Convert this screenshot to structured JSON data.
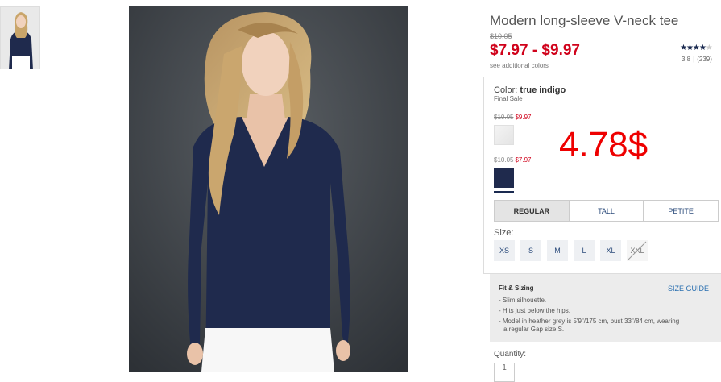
{
  "product": {
    "title": "Modern long-sleeve V-neck tee",
    "old_price": "$10.05",
    "price_range": "$7.97 - $9.97",
    "see_colors": "see additional colors",
    "stars_full": "★★★★",
    "stars_empty": "★",
    "rating_value": "3.8",
    "rating_separator": "|",
    "review_count": "(239)"
  },
  "color": {
    "label": "Color:",
    "name": "true indigo",
    "final_sale": "Final Sale",
    "swatches": [
      {
        "old_price": "$10.05",
        "price": "$9.97",
        "color": "#f0f0f0"
      },
      {
        "old_price": "$10.05",
        "price": "$7.97",
        "color": "#1f2a4d"
      }
    ]
  },
  "overlay_price": "4.78$",
  "fit_tabs": [
    "REGULAR",
    "TALL",
    "PETITE"
  ],
  "size": {
    "label": "Size:",
    "options": [
      "XS",
      "S",
      "M",
      "L",
      "XL",
      "XXL"
    ]
  },
  "fit": {
    "title": "Fit & Sizing",
    "size_guide": "SIZE GUIDE",
    "lines": [
      "- Slim silhouette.",
      "- Hits just below the hips.",
      "- Model in heather grey is 5'9\"/175 cm, bust 33\"/84 cm, wearing",
      "a regular Gap size S."
    ]
  },
  "quantity": {
    "label": "Quantity:",
    "value": "1"
  },
  "colors": {
    "sale_red": "#d0021b",
    "navy": "#1a2a50",
    "link_blue": "#2a6fb0"
  }
}
